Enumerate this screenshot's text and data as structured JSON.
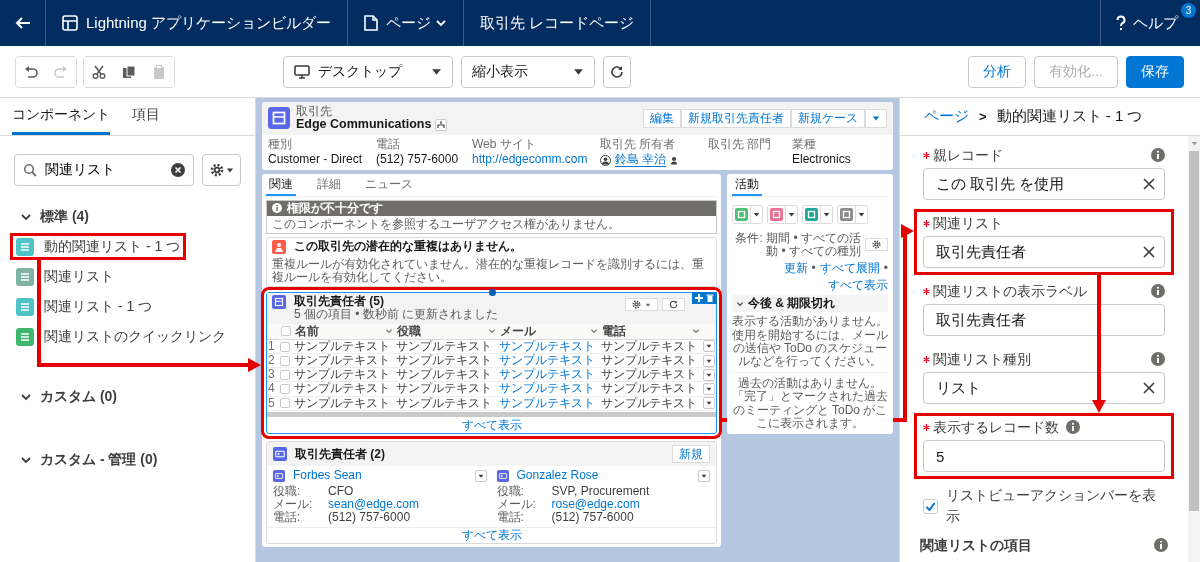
{
  "top_bar": {
    "app_title": "Lightning アプリケーションビルダー",
    "page_menu": "ページ",
    "page_name": "取引先 レコードページ",
    "help": "ヘルプ",
    "help_badge": "3"
  },
  "toolbar": {
    "tool_groups": [
      [
        {
          "kind": "undo",
          "disabled": false
        },
        {
          "kind": "redo",
          "disabled": true
        }
      ],
      [
        {
          "kind": "cut",
          "disabled": false
        },
        {
          "kind": "copy",
          "disabled": false
        },
        {
          "kind": "paste",
          "disabled": true
        }
      ]
    ],
    "device": "デスクトップ",
    "view": "縮小表示",
    "actions": [
      {
        "label": "分析",
        "kind": "neutral",
        "disabled": false
      },
      {
        "label": "有効化...",
        "kind": "neutral",
        "disabled": true
      },
      {
        "label": "保存",
        "kind": "brand",
        "disabled": false
      }
    ]
  },
  "palette": {
    "tabs": [
      {
        "label": "コンポーネント",
        "selected": true
      },
      {
        "label": "項目",
        "selected": false
      }
    ],
    "search": {
      "value": "関連リスト"
    },
    "groups": [
      {
        "label": "標準 (4)",
        "expanded": true,
        "items": [
          {
            "label": "動的関連リスト - 1 つ",
            "color": "#4fc3c7",
            "highlighted": true
          },
          {
            "label": "関連リスト",
            "color": "#7fb3a4",
            "highlighted": false
          },
          {
            "label": "関連リスト - 1 つ",
            "color": "#4fc3c7",
            "highlighted": false
          },
          {
            "label": "関連リストのクイックリンク",
            "color": "#3fb76f",
            "highlighted": false
          }
        ]
      },
      {
        "label": "カスタム (0)",
        "expanded": true
      },
      {
        "label": "カスタム - 管理 (0)",
        "expanded": true
      }
    ]
  },
  "canvas": {
    "record": {
      "object": "取引先",
      "name": "Edge Communications",
      "actions": [
        "編集",
        "新規取引先責任者",
        "新規ケース"
      ],
      "fields": [
        {
          "label": "種別",
          "value": "Customer - Direct",
          "kind": "text"
        },
        {
          "label": "電話",
          "value": "(512) 757-6000",
          "kind": "text"
        },
        {
          "label": "Web サイト",
          "value": "http://edgecomm.com",
          "kind": "link"
        },
        {
          "label": "取引先 所有者",
          "value": "鈴島 幸治",
          "kind": "user"
        },
        {
          "label": "取引先 部門"
        },
        {
          "label": "業種",
          "value": "Electronics",
          "kind": "text"
        }
      ]
    },
    "tabs": [
      {
        "label": "関連",
        "selected": true
      },
      {
        "label": "詳細",
        "selected": false
      },
      {
        "label": "ニュース",
        "selected": false
      }
    ],
    "access_warning": {
      "title": "権限が不十分です",
      "message": "このコンポーネントを参照するユーザアクセス権がありません。"
    },
    "duplicates": {
      "title": "この取引先の潜在的な重複はありません。",
      "message": "重複ルールが有効化されていません。潜在的な重複レコードを識別するには、重複ルールを有効化してください。"
    },
    "related_table": {
      "title": "取引先責任者 (5)",
      "subtitle": "5 個の項目 • 数秒前 に更新されました",
      "selected": true,
      "highlighted": true,
      "all_checked": false,
      "columns": [
        {
          "label": "名前",
          "kind": "text"
        },
        {
          "label": "役職",
          "kind": "text"
        },
        {
          "label": "メール",
          "kind": "link"
        },
        {
          "label": "電話",
          "kind": "text"
        }
      ],
      "rows": [
        {
          "number": "1",
          "checked": false,
          "cells": [
            "サンプルテキスト",
            "サンプルテキスト",
            "サンプルテキスト",
            "サンプルテキスト"
          ]
        },
        {
          "number": "2",
          "checked": false,
          "cells": [
            "サンプルテキスト",
            "サンプルテキスト",
            "サンプルテキスト",
            "サンプルテキスト"
          ]
        },
        {
          "number": "3",
          "checked": false,
          "cells": [
            "サンプルテキスト",
            "サンプルテキスト",
            "サンプルテキスト",
            "サンプルテキスト"
          ]
        },
        {
          "number": "4",
          "checked": false,
          "cells": [
            "サンプルテキスト",
            "サンプルテキスト",
            "サンプルテキスト",
            "サンプルテキスト"
          ]
        },
        {
          "number": "5",
          "checked": false,
          "cells": [
            "サンプルテキスト",
            "サンプルテキスト",
            "サンプルテキスト",
            "サンプルテキスト"
          ]
        }
      ],
      "footer": "すべて表示"
    },
    "related_tiles": {
      "title": "取引先責任者 (2)",
      "button": "新規",
      "tiles": [
        {
          "name": "Forbes Sean",
          "fields": [
            {
              "label": "役職:",
              "value": "CFO",
              "kind": "text"
            },
            {
              "label": "メール:",
              "value": "sean@edge.com",
              "kind": "link"
            },
            {
              "label": "電話:",
              "value": "(512) 757-6000",
              "kind": "text"
            }
          ]
        },
        {
          "name": "Gonzalez Rose",
          "fields": [
            {
              "label": "役職:",
              "value": "SVP, Procurement",
              "kind": "text"
            },
            {
              "label": "メール:",
              "value": "rose@edge.com",
              "kind": "link"
            },
            {
              "label": "電話:",
              "value": "(512) 757-6000",
              "kind": "text"
            }
          ]
        }
      ],
      "footer": "すべて表示"
    },
    "activity": {
      "tab": "活動",
      "tools": [
        {
          "color": "#4bc076"
        },
        {
          "color": "#eb7092"
        },
        {
          "color": "#1fa89a"
        },
        {
          "color": "#8b8b8b"
        }
      ],
      "filter": "条件: 期間 • すべての活動 • すべての種別",
      "separator": "•",
      "links": [
        "更新",
        "すべて展開",
        "すべて表示"
      ],
      "section": "今後 & 期限切れ",
      "empty": "表示する活動がありません。",
      "hint": "使用を開始するには、メールの送信や ToDo のスケジュールなどを行ってください。",
      "past": "過去の活動はありません。「完了」とマークされた過去のミーティングと ToDo がここに表示されます。"
    }
  },
  "properties": {
    "breadcrumb": [
      {
        "label": "ページ",
        "kind": "link"
      },
      {
        "label": "動的関連リスト - 1 つ",
        "kind": "current"
      }
    ],
    "breadcrumb_separator": ">",
    "fields": [
      {
        "kind": "lookup",
        "label": "親レコード",
        "required": true,
        "info": true,
        "value": "この 取引先 を使用",
        "highlighted": false
      },
      {
        "kind": "lookup",
        "label": "関連リスト",
        "required": true,
        "value": "取引先責任者",
        "highlighted": true
      },
      {
        "kind": "input",
        "label": "関連リストの表示ラベル",
        "required": true,
        "info": true,
        "value": "取引先責任者",
        "highlighted": false
      },
      {
        "kind": "lookup",
        "label": "関連リスト種別",
        "required": true,
        "info": true,
        "value": "リスト",
        "highlighted": false
      },
      {
        "kind": "input",
        "label": "表示するレコード数",
        "required": true,
        "info": true,
        "info_inline": true,
        "value": "5",
        "highlighted": true
      },
      {
        "kind": "checkbox",
        "label": "リストビューアクションバーを表示",
        "checked": true
      },
      {
        "kind": "heading",
        "label": "関連リストの項目",
        "info": true
      }
    ]
  }
}
